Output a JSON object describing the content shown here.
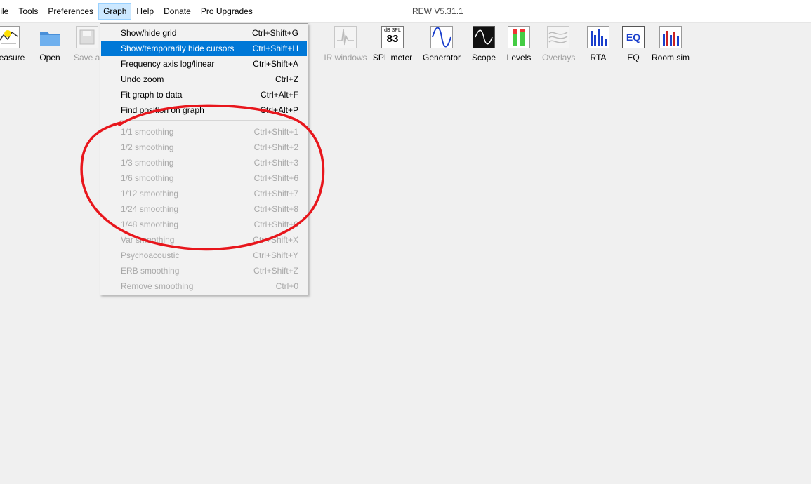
{
  "app": {
    "title": "REW V5.31.1"
  },
  "menubar": {
    "items": [
      "File",
      "Tools",
      "Preferences",
      "Graph",
      "Help",
      "Donate",
      "Pro Upgrades"
    ]
  },
  "toolbar": {
    "items": [
      {
        "label": "Measure",
        "icon": "measure-icon",
        "enabled": true
      },
      {
        "label": "Open",
        "icon": "folder-icon",
        "enabled": true
      },
      {
        "label": "Save all",
        "icon": "save-icon",
        "enabled": false
      },
      {
        "label": "IR windows",
        "icon": "ir-windows-icon",
        "enabled": false
      },
      {
        "label": "SPL meter",
        "icon": "spl-meter-icon",
        "enabled": true,
        "badge_top": "dB SPL",
        "badge_value": "83"
      },
      {
        "label": "Generator",
        "icon": "sine-wave-icon",
        "enabled": true
      },
      {
        "label": "Scope",
        "icon": "scope-icon",
        "enabled": true
      },
      {
        "label": "Levels",
        "icon": "levels-icon",
        "enabled": true
      },
      {
        "label": "Overlays",
        "icon": "overlays-icon",
        "enabled": false
      },
      {
        "label": "RTA",
        "icon": "rta-icon",
        "enabled": true
      },
      {
        "label": "EQ",
        "icon": "eq-icon",
        "enabled": true,
        "badge_text": "EQ"
      },
      {
        "label": "Room sim",
        "icon": "room-sim-icon",
        "enabled": true
      }
    ]
  },
  "graph_menu": {
    "items": [
      {
        "label": "Show/hide grid",
        "shortcut": "Ctrl+Shift+G",
        "enabled": true
      },
      {
        "label": "Show/temporarily hide cursors",
        "shortcut": "Ctrl+Shift+H",
        "enabled": true,
        "highlighted": true
      },
      {
        "label": "Frequency axis log/linear",
        "shortcut": "Ctrl+Shift+A",
        "enabled": true
      },
      {
        "label": "Undo zoom",
        "shortcut": "Ctrl+Z",
        "enabled": true
      },
      {
        "label": "Fit graph to data",
        "shortcut": "Ctrl+Alt+F",
        "enabled": true
      },
      {
        "label": "Find position on graph",
        "shortcut": "Ctrl+Alt+P",
        "enabled": true
      },
      {
        "label": "1/1 smoothing",
        "shortcut": "Ctrl+Shift+1",
        "enabled": false
      },
      {
        "label": "1/2 smoothing",
        "shortcut": "Ctrl+Shift+2",
        "enabled": false
      },
      {
        "label": "1/3 smoothing",
        "shortcut": "Ctrl+Shift+3",
        "enabled": false
      },
      {
        "label": "1/6 smoothing",
        "shortcut": "Ctrl+Shift+6",
        "enabled": false
      },
      {
        "label": "1/12 smoothing",
        "shortcut": "Ctrl+Shift+7",
        "enabled": false
      },
      {
        "label": "1/24 smoothing",
        "shortcut": "Ctrl+Shift+8",
        "enabled": false
      },
      {
        "label": "1/48 smoothing",
        "shortcut": "Ctrl+Shift+9",
        "enabled": false
      },
      {
        "label": "Var smoothing",
        "shortcut": "Ctrl+Shift+X",
        "enabled": false
      },
      {
        "label": "Psychoacoustic",
        "shortcut": "Ctrl+Shift+Y",
        "enabled": false
      },
      {
        "label": "ERB smoothing",
        "shortcut": "Ctrl+Shift+Z",
        "enabled": false
      },
      {
        "label": "Remove smoothing",
        "shortcut": "Ctrl+0",
        "enabled": false
      }
    ]
  },
  "colors": {
    "highlight": "#0078d7",
    "annotation": "#e8161c",
    "disabled_text": "#a8a8a8"
  }
}
